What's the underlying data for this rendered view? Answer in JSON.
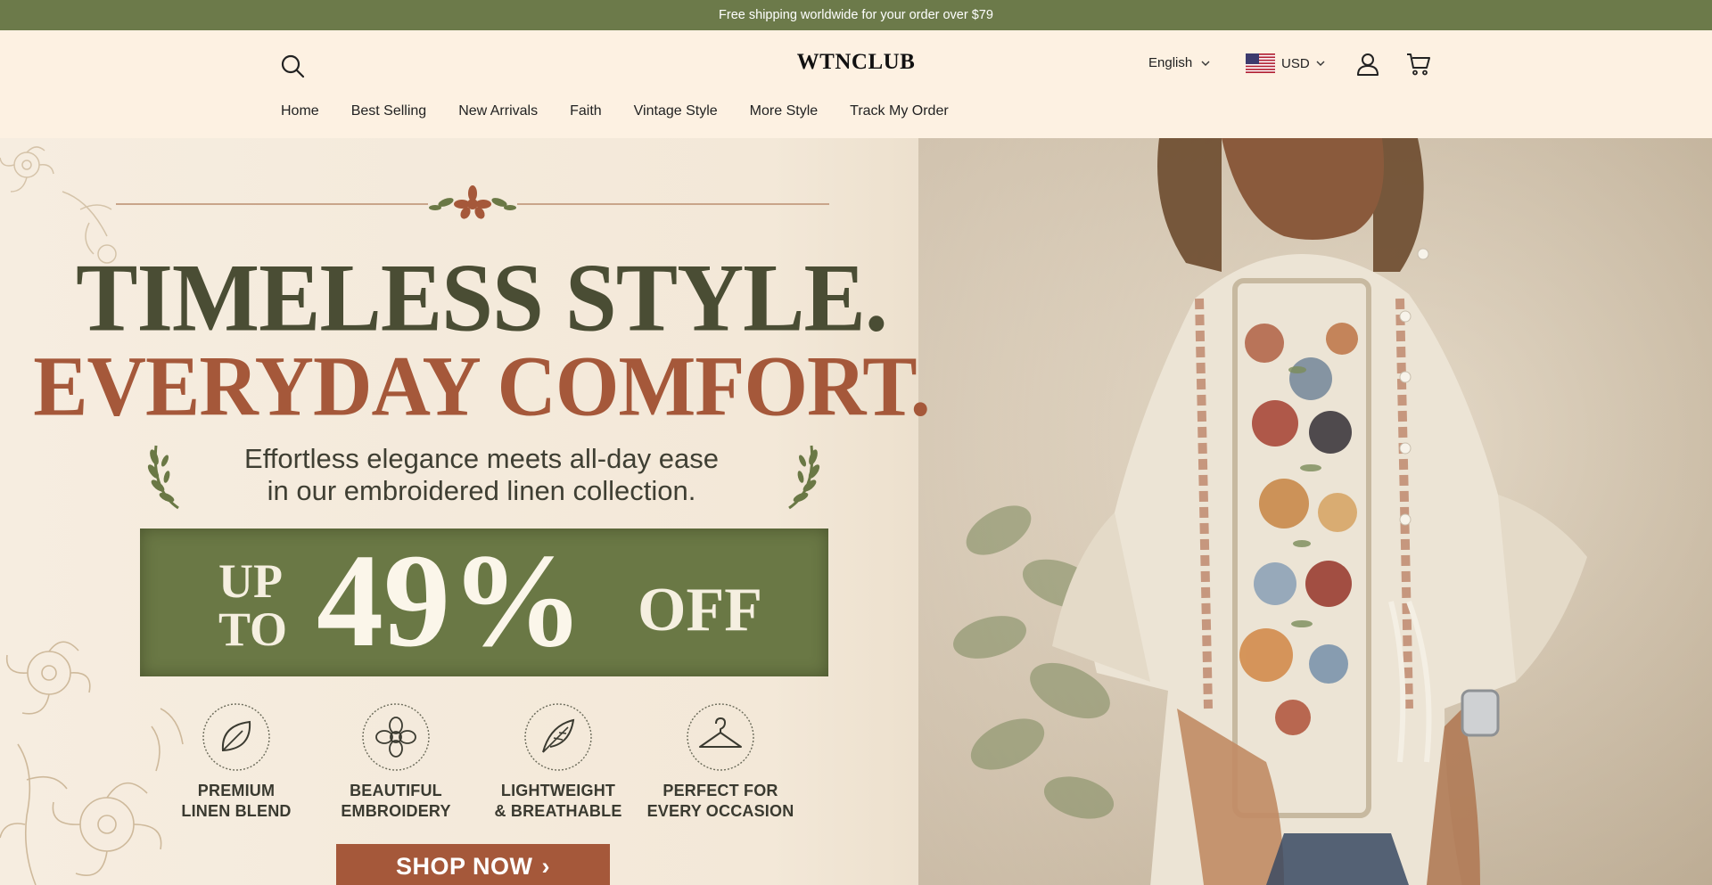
{
  "announcement": "Free shipping worldwide for your order over $79",
  "header": {
    "logo": "WTNCLUB",
    "language": "English",
    "currency": "USD",
    "icons": [
      "search-icon",
      "us-flag-icon",
      "account-icon",
      "cart-icon"
    ]
  },
  "nav": {
    "items": [
      {
        "label": "Home"
      },
      {
        "label": "Best Selling"
      },
      {
        "label": "New Arrivals"
      },
      {
        "label": "Faith"
      },
      {
        "label": "Vintage Style"
      },
      {
        "label": "More Style"
      },
      {
        "label": "Track My Order"
      }
    ]
  },
  "hero": {
    "headline_1": "TIMELESS STYLE.",
    "headline_2": "EVERYDAY COMFORT.",
    "subline_1": "Effortless elegance meets all-day ease",
    "subline_2": "in our embroidered linen collection.",
    "deal_up": "UP",
    "deal_to": "TO",
    "deal_percent": "49%",
    "deal_off": "OFF",
    "features": [
      {
        "line1": "PREMIUM",
        "line2": "LINEN BLEND",
        "icon": "leaf-icon"
      },
      {
        "line1": "BEAUTIFUL",
        "line2": "EMBROIDERY",
        "icon": "flower-icon"
      },
      {
        "line1": "LIGHTWEIGHT",
        "line2": "& BREATHABLE",
        "icon": "feather-icon"
      },
      {
        "line1": "PERFECT FOR",
        "line2": "EVERY OCCASION",
        "icon": "hanger-icon"
      }
    ],
    "cta": "SHOP NOW"
  },
  "colors": {
    "announcement_bg": "#6c7a4a",
    "header_bg": "#fdf1e2",
    "headline_dark": "#4a4d34",
    "headline_accent": "#a5583a",
    "deal_bg": "#6a7845",
    "cta_bg": "#a5583a"
  }
}
